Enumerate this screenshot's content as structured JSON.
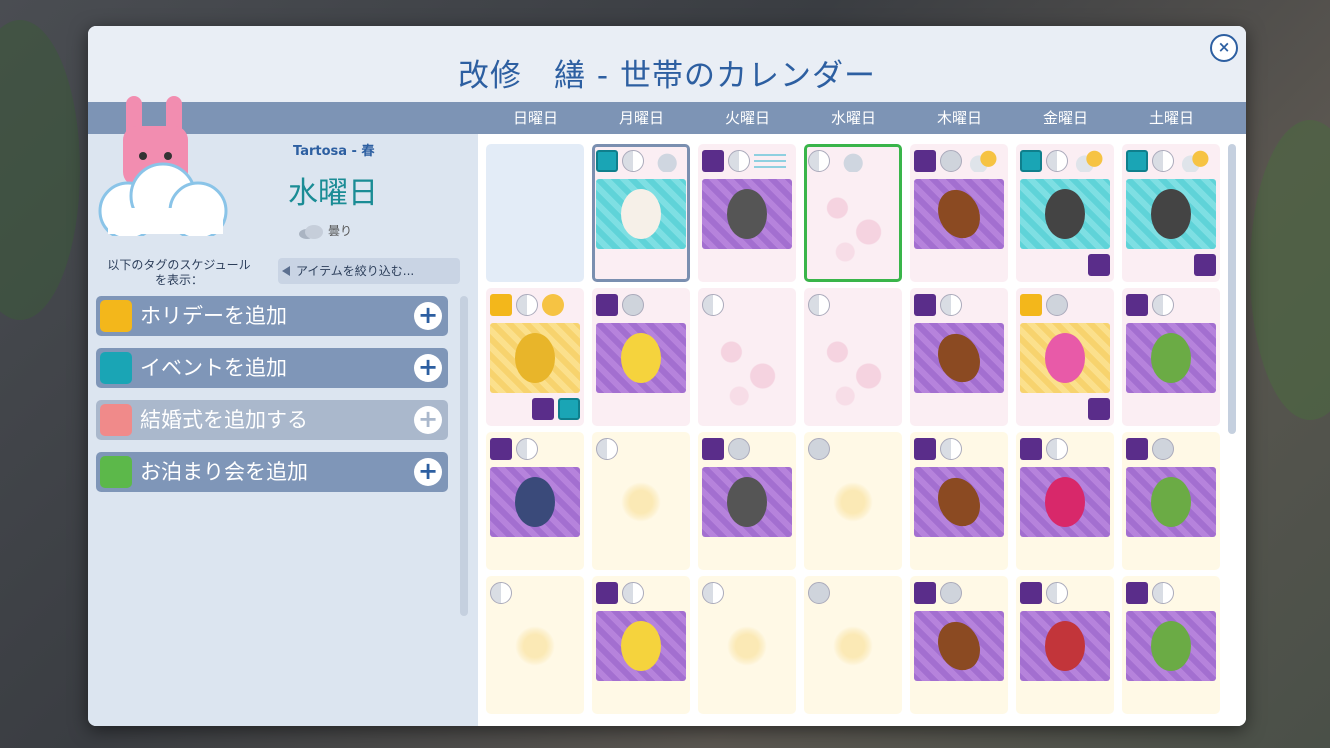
{
  "title": "改修　繕 - 世帯のカレンダー",
  "close_label": "×",
  "weekdays": [
    "日曜日",
    "月曜日",
    "火曜日",
    "水曜日",
    "木曜日",
    "金曜日",
    "土曜日"
  ],
  "selected_day": {
    "region_season": "Tartosa - 春",
    "day_name": "水曜日",
    "weather": "曇り"
  },
  "tag_filter": {
    "label": "以下のタグのスケジュール\nを表示：",
    "value": "アイテムを絞り込む..."
  },
  "add_buttons": [
    {
      "label": "ホリデーを追加",
      "icon": "balloons-icon",
      "color": "#f3b71b",
      "enabled": true
    },
    {
      "label": "イベントを追加",
      "icon": "calendar-check-icon",
      "color": "#1aa5b5",
      "enabled": true
    },
    {
      "label": "結婚式を追加する",
      "icon": "wedding-rings-icon",
      "color": "#f08a8a",
      "enabled": false
    },
    {
      "label": "お泊まり会を追加",
      "icon": "house-plus-icon",
      "color": "#5cb84a",
      "enabled": true
    }
  ],
  "plus_label": "+",
  "calendar": [
    [
      {
        "bg": "blue",
        "top": [],
        "art": null,
        "corner": []
      },
      {
        "bg": "pink",
        "top": [
          "event",
          "moon",
          "cloud"
        ],
        "art": {
          "bg": "teal",
          "obj": "photo",
          "name": "photo-edit-icon"
        },
        "corner": [],
        "selected": true
      },
      {
        "bg": "pink",
        "top": [
          "like",
          "moon",
          "wind"
        ],
        "art": {
          "bg": "purple",
          "obj": "laptop",
          "name": "laptop-smiley-icon"
        },
        "corner": []
      },
      {
        "bg": "pink",
        "top": [
          "moon",
          "cloud"
        ],
        "art": null,
        "corner": [],
        "today": true,
        "flowers": true
      },
      {
        "bg": "pink",
        "top": [
          "like",
          "moonfull",
          "sun"
        ],
        "art": {
          "bg": "purple",
          "obj": "ball",
          "name": "football-icon"
        },
        "corner": []
      },
      {
        "bg": "pink",
        "top": [
          "event",
          "moon",
          "sun"
        ],
        "art": {
          "bg": "teal",
          "obj": "mic",
          "name": "microphone-icon"
        },
        "corner": [
          "like"
        ]
      },
      {
        "bg": "pink",
        "top": [
          "event",
          "moon",
          "sun"
        ],
        "art": {
          "bg": "teal",
          "obj": "mic",
          "name": "microphone-icon"
        },
        "corner": [
          "like"
        ]
      }
    ],
    [
      {
        "bg": "pink",
        "top": [
          "holiday",
          "moon",
          "sunonly"
        ],
        "art": {
          "bg": "yellow",
          "obj": "gold",
          "name": "award-ribbon-icon"
        },
        "corner": [
          "like",
          "event"
        ]
      },
      {
        "bg": "pink",
        "top": [
          "like",
          "moonfull"
        ],
        "art": {
          "bg": "purple",
          "obj": "face",
          "name": "jester-icon"
        },
        "corner": []
      },
      {
        "bg": "pink",
        "top": [
          "moon"
        ],
        "art": null,
        "corner": [],
        "flowers": true
      },
      {
        "bg": "pink",
        "top": [
          "moon"
        ],
        "art": null,
        "corner": [],
        "flowers": true
      },
      {
        "bg": "pink",
        "top": [
          "like",
          "moon"
        ],
        "art": {
          "bg": "purple",
          "obj": "ball",
          "name": "football-icon"
        },
        "corner": []
      },
      {
        "bg": "pink",
        "top": [
          "holiday",
          "moonfull"
        ],
        "art": {
          "bg": "yellow",
          "obj": "heart",
          "name": "hearts-icon"
        },
        "corner": [
          "like"
        ]
      },
      {
        "bg": "pink",
        "top": [
          "like",
          "moon"
        ],
        "art": {
          "bg": "purple",
          "obj": "veg",
          "name": "vegetables-icon"
        },
        "corner": []
      }
    ],
    [
      {
        "bg": "yellow",
        "top": [
          "like",
          "moon"
        ],
        "art": {
          "bg": "purple",
          "obj": "tent",
          "name": "tent-icon"
        },
        "corner": []
      },
      {
        "bg": "yellow",
        "top": [
          "moon"
        ],
        "art": null,
        "corner": [],
        "sun": true
      },
      {
        "bg": "yellow",
        "top": [
          "like",
          "moonfull"
        ],
        "art": {
          "bg": "purple",
          "obj": "laptop",
          "name": "laptop-smiley-icon"
        },
        "corner": []
      },
      {
        "bg": "yellow",
        "top": [
          "moonfull"
        ],
        "art": null,
        "corner": [],
        "sun": true
      },
      {
        "bg": "yellow",
        "top": [
          "like",
          "moon"
        ],
        "art": {
          "bg": "purple",
          "obj": "ball",
          "name": "football-icon"
        },
        "corner": []
      },
      {
        "bg": "yellow",
        "top": [
          "like",
          "moon"
        ],
        "art": {
          "bg": "purple",
          "obj": "pom",
          "name": "pompom-icon"
        },
        "corner": []
      },
      {
        "bg": "yellow",
        "top": [
          "like",
          "moonfull"
        ],
        "art": {
          "bg": "purple",
          "obj": "veg",
          "name": "sheep-icon"
        },
        "corner": []
      }
    ],
    [
      {
        "bg": "yellow",
        "top": [
          "moon"
        ],
        "art": null,
        "corner": [],
        "sun": true
      },
      {
        "bg": "yellow",
        "top": [
          "like",
          "moon"
        ],
        "art": {
          "bg": "purple",
          "obj": "face",
          "name": "jester-icon"
        },
        "corner": []
      },
      {
        "bg": "yellow",
        "top": [
          "moon"
        ],
        "art": null,
        "corner": [],
        "sun": true
      },
      {
        "bg": "yellow",
        "top": [
          "moonfull"
        ],
        "art": null,
        "corner": [],
        "sun": true
      },
      {
        "bg": "yellow",
        "top": [
          "like",
          "moonfull"
        ],
        "art": {
          "bg": "purple",
          "obj": "ball",
          "name": "football-icon"
        },
        "corner": []
      },
      {
        "bg": "yellow",
        "top": [
          "like",
          "moon"
        ],
        "art": {
          "bg": "purple",
          "obj": "mouth",
          "name": "spicy-mouth-icon"
        },
        "corner": []
      },
      {
        "bg": "yellow",
        "top": [
          "like",
          "moon"
        ],
        "art": {
          "bg": "purple",
          "obj": "veg",
          "name": "vegetables-icon"
        },
        "corner": []
      }
    ]
  ]
}
